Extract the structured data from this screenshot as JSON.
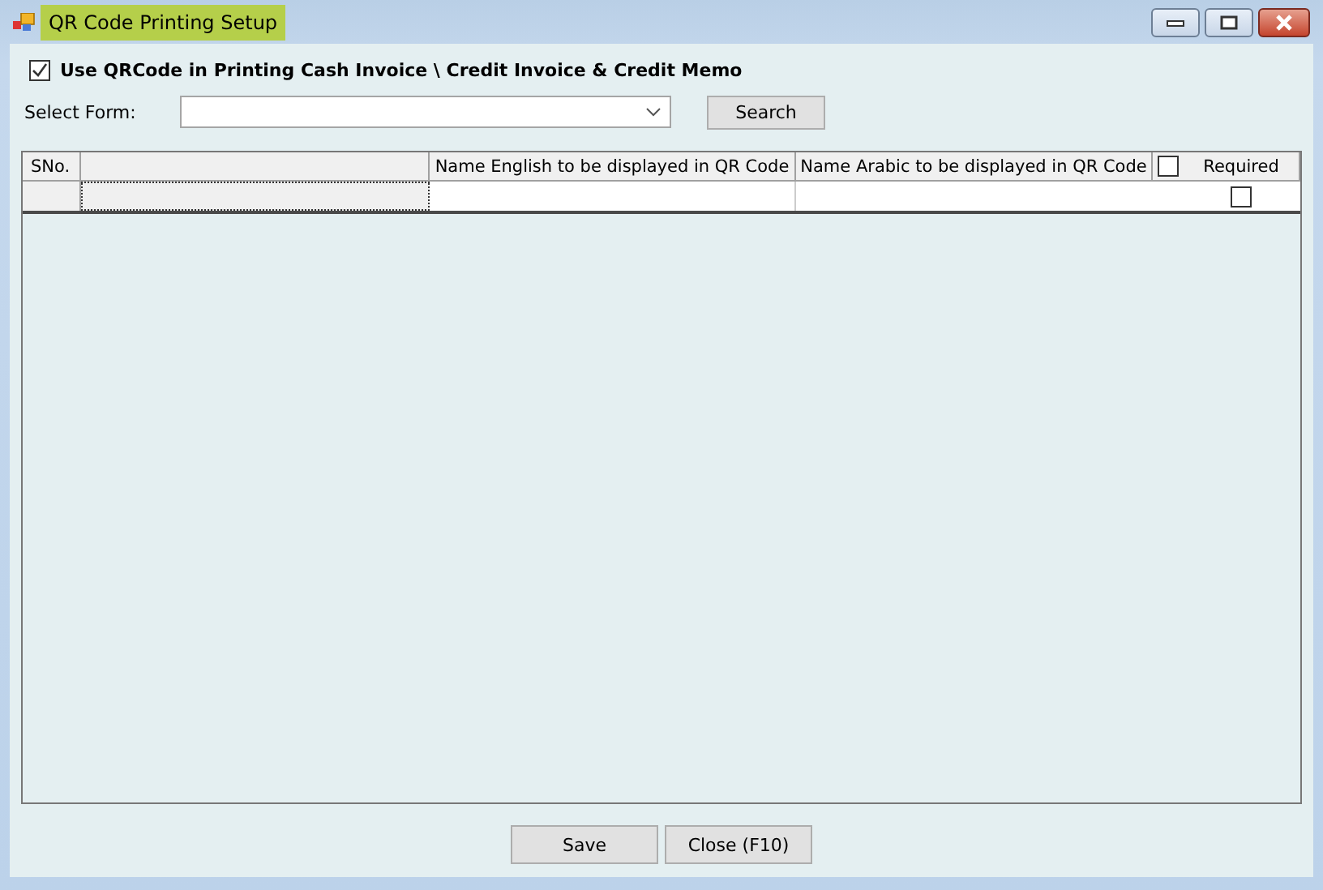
{
  "window": {
    "title": "QR Code Printing Setup"
  },
  "use_qr": {
    "label": "Use QRCode in Printing Cash Invoice \\ Credit Invoice & Credit Memo",
    "checked": true
  },
  "select_form": {
    "label": "Select Form:"
  },
  "search_button": "Search",
  "table": {
    "columns": [
      {
        "label": "SNo."
      },
      {},
      {
        "label": "Name English to be displayed in QR Code"
      },
      {
        "label": "Name Arabic to be displayed in QR Code"
      },
      {
        "label": "Required",
        "header_checked": false
      }
    ],
    "rows": [
      {
        "required": false
      }
    ]
  },
  "buttons": [
    "Save",
    "Close (F10)"
  ]
}
